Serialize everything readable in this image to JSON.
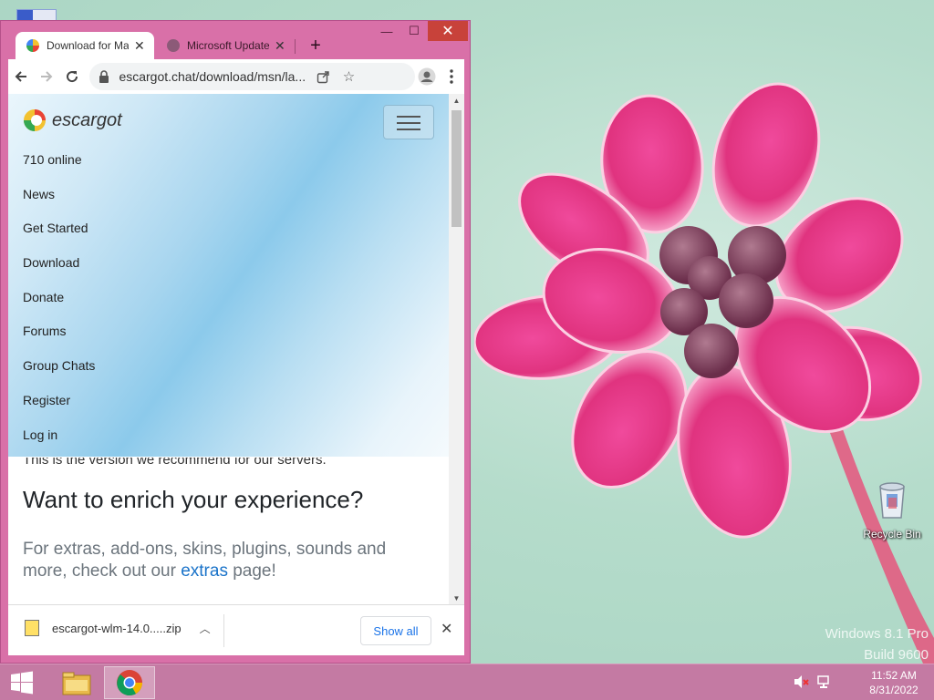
{
  "browser": {
    "tabs": [
      {
        "title": "Download for Mac",
        "active": true
      },
      {
        "title": "Microsoft Update Catalog",
        "active": false
      }
    ],
    "new_tab_label": "+",
    "url": "escargot.chat/download/msn/la...",
    "window_controls": {
      "minimize": "—",
      "maximize": "☐",
      "close": "✕"
    }
  },
  "page": {
    "logo": "escargot",
    "online_status": "710 online",
    "menu": [
      "News",
      "Get Started",
      "Download",
      "Donate",
      "Forums",
      "Group Chats",
      "Register",
      "Log in"
    ],
    "cut_text": "This is the version we recommend for our servers.",
    "heading": "Want to enrich your experience?",
    "lead_before": "For extras, add-ons, skins, plugins, sounds and more, check out our ",
    "lead_link": "extras",
    "lead_after": " page!"
  },
  "downloads": {
    "filename": "escargot-wlm-14.0.....zip",
    "show_all": "Show all"
  },
  "desktop": {
    "recycle_bin": "Recycle Bin",
    "watermark_line1": "Windows 8.1 Pro",
    "watermark_line2": "Build 9600"
  },
  "taskbar": {
    "time": "11:52 AM",
    "date": "8/31/2022"
  },
  "colors": {
    "window_frame": "#d970a8",
    "taskbar": "#c47aa3",
    "link": "#1a73c9",
    "close_button": "#c8423a"
  }
}
